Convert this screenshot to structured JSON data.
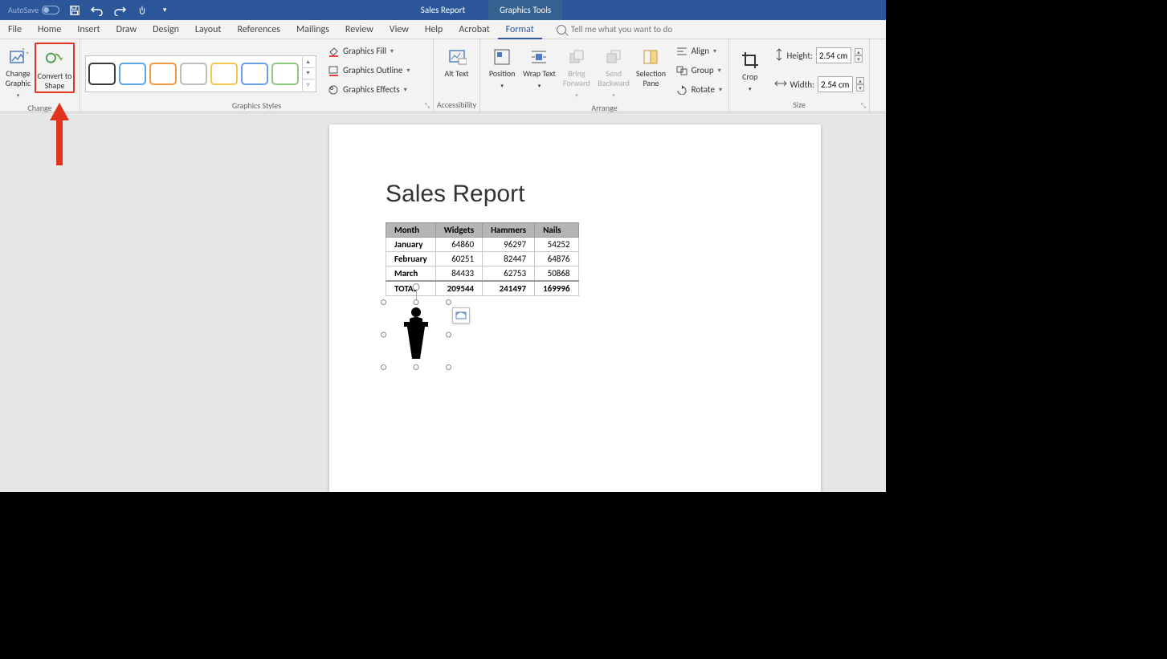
{
  "titlebar": {
    "autosave": "AutoSave",
    "doc_title": "Sales Report",
    "context_tab": "Graphics Tools"
  },
  "menu": {
    "tabs": [
      "File",
      "Home",
      "Insert",
      "Draw",
      "Design",
      "Layout",
      "References",
      "Mailings",
      "Review",
      "View",
      "Help",
      "Acrobat",
      "Format"
    ],
    "active_index": 12,
    "tellme_placeholder": "Tell me what you want to do"
  },
  "ribbon": {
    "change": {
      "label": "Change",
      "change_graphic": "Change Graphic",
      "convert_to_shape": "Convert to Shape"
    },
    "styles": {
      "label": "Graphics Styles",
      "fill": "Graphics Fill",
      "outline": "Graphics Outline",
      "effects": "Graphics Effects",
      "swatch_colors": [
        "#3a3a3a",
        "#5aa6e6",
        "#ed9b40",
        "#bdbdbd",
        "#f4c84c",
        "#6b9de8",
        "#8cc97a"
      ]
    },
    "accessibility": {
      "label": "Accessibility",
      "alt_text": "Alt Text"
    },
    "arrange": {
      "label": "Arrange",
      "position": "Position",
      "wrap": "Wrap Text",
      "bring_forward": "Bring Forward",
      "send_backward": "Send Backward",
      "selection_pane": "Selection Pane",
      "align": "Align",
      "group": "Group",
      "rotate": "Rotate"
    },
    "size": {
      "label": "Size",
      "crop": "Crop",
      "height_lbl": "Height:",
      "width_lbl": "Width:",
      "height_val": "2.54 cm",
      "width_val": "2.54 cm"
    }
  },
  "document": {
    "title": "Sales Report",
    "table": {
      "headers": [
        "Month",
        "Widgets",
        "Hammers",
        "Nails"
      ],
      "rows": [
        [
          "January",
          "64860",
          "96297",
          "54252"
        ],
        [
          "February",
          "60251",
          "82447",
          "64876"
        ],
        [
          "March",
          "84433",
          "62753",
          "50868"
        ]
      ],
      "total": [
        "TOTAL",
        "209544",
        "241497",
        "169996"
      ]
    }
  }
}
